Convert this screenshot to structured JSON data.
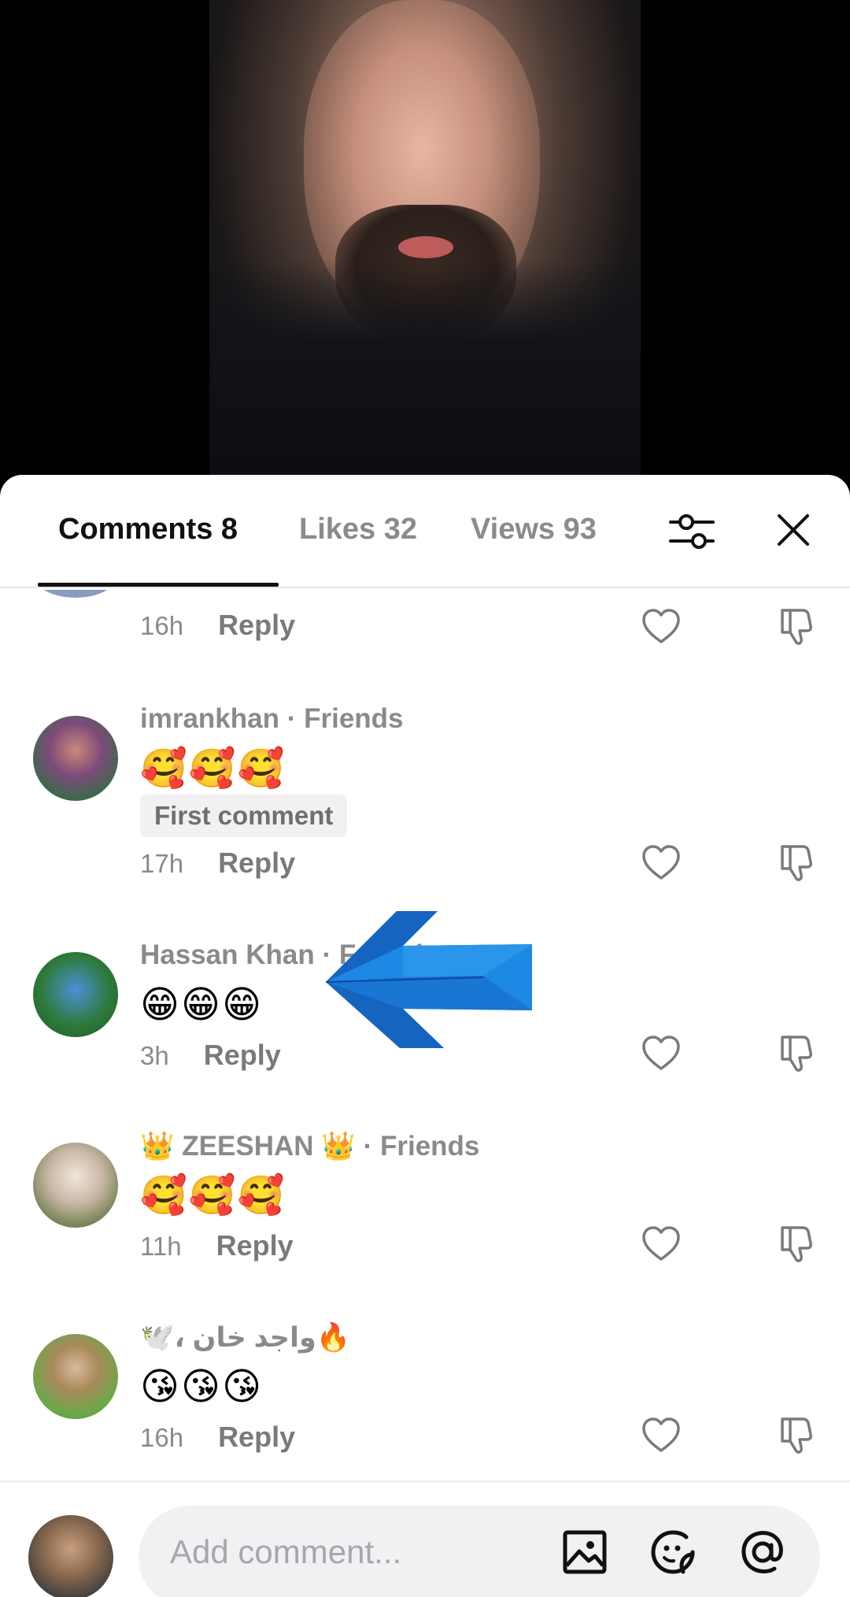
{
  "tabs": {
    "comments": "Comments 8",
    "likes": "Likes 32",
    "views": "Views 93"
  },
  "comments": [
    {
      "time": "16h",
      "reply": "Reply",
      "partial": true
    },
    {
      "username": "imrankhan",
      "relation": "· Friends",
      "emojis": "🥰🥰🥰",
      "badge": "First comment",
      "time": "17h",
      "reply": "Reply"
    },
    {
      "username": "Hassan Khan",
      "relation": "· Friends",
      "emojis": "😁😁😁",
      "time": "3h",
      "reply": "Reply"
    },
    {
      "username": "👑 ZEESHAN 👑",
      "relation": "· Friends",
      "emojis": "🥰🥰🥰",
      "time": "11h",
      "reply": "Reply"
    },
    {
      "username": "🕊️، واجد خان🔥",
      "emojis": "😘😘😘",
      "time": "16h",
      "reply": "Reply"
    }
  ],
  "composer": {
    "placeholder": "Add comment..."
  },
  "colors": {
    "arrow": "#1e88e5",
    "text_muted": "#8a8a8a"
  },
  "icons": [
    "filter-icon",
    "close-icon",
    "heart-icon",
    "dislike-icon",
    "image-icon",
    "sticker-icon",
    "mention-icon"
  ]
}
